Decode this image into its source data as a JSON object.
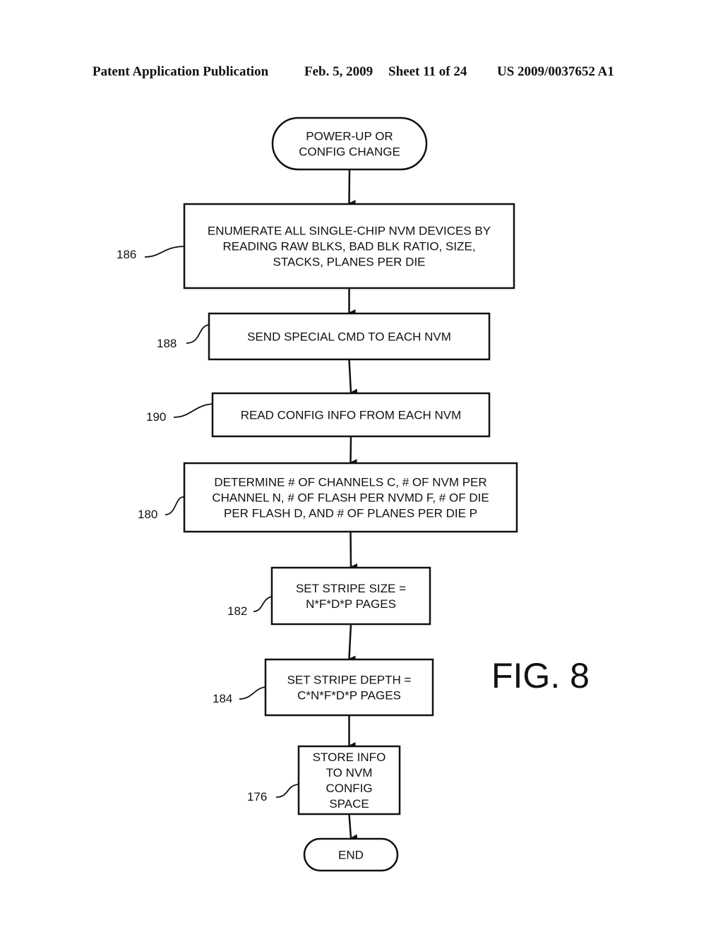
{
  "header": {
    "publication": "Patent Application Publication",
    "date": "Feb. 5, 2009",
    "sheet": "Sheet 11 of 24",
    "number": "US 2009/0037652 A1"
  },
  "figure_label": "FIG. 8",
  "nodes": [
    {
      "id": "start",
      "shape": "terminal",
      "ref": "",
      "lines": [
        "POWER-UP OR",
        "CONFIG CHANGE"
      ]
    },
    {
      "id": "n186",
      "shape": "process",
      "ref": "186",
      "lines": [
        "ENUMERATE ALL SINGLE-CHIP NVM DEVICES BY",
        "READING RAW BLKS, BAD BLK RATIO, SIZE,",
        "STACKS, PLANES PER DIE"
      ]
    },
    {
      "id": "n188",
      "shape": "process",
      "ref": "188",
      "lines": [
        "SEND SPECIAL CMD TO EACH NVM"
      ]
    },
    {
      "id": "n190",
      "shape": "process",
      "ref": "190",
      "lines": [
        "READ CONFIG INFO FROM EACH NVM"
      ]
    },
    {
      "id": "n180",
      "shape": "process",
      "ref": "180",
      "lines": [
        "DETERMINE # OF CHANNELS C, # OF NVM PER",
        "CHANNEL N, # OF FLASH PER NVMD F, # OF DIE",
        "PER FLASH D, AND # OF PLANES PER DIE P"
      ]
    },
    {
      "id": "n182",
      "shape": "process",
      "ref": "182",
      "lines": [
        "SET STRIPE SIZE =",
        "N*F*D*P PAGES"
      ]
    },
    {
      "id": "n184",
      "shape": "process",
      "ref": "184",
      "lines": [
        "SET STRIPE DEPTH =",
        "C*N*F*D*P PAGES"
      ]
    },
    {
      "id": "n176",
      "shape": "process",
      "ref": "176",
      "lines": [
        "STORE INFO",
        "TO NVM",
        "CONFIG",
        "SPACE"
      ]
    },
    {
      "id": "end",
      "shape": "terminal",
      "ref": "",
      "lines": [
        "END"
      ]
    }
  ],
  "edges": [
    {
      "from": "start",
      "to": "n186"
    },
    {
      "from": "n186",
      "to": "n188"
    },
    {
      "from": "n188",
      "to": "n190"
    },
    {
      "from": "n190",
      "to": "n180"
    },
    {
      "from": "n180",
      "to": "n182"
    },
    {
      "from": "n182",
      "to": "n184"
    },
    {
      "from": "n184",
      "to": "n176"
    },
    {
      "from": "n176",
      "to": "end"
    }
  ]
}
